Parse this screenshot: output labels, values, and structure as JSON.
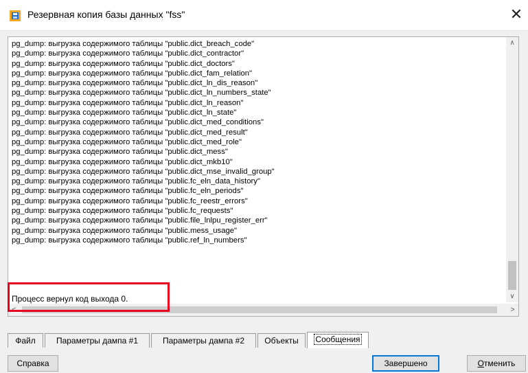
{
  "window": {
    "title": "Резервная копия базы данных \"fss\"",
    "close_glyph": "✕"
  },
  "log": {
    "lines": [
      "pg_dump: выгрузка содержимого таблицы \"public.dict_breach_code\"",
      "pg_dump: выгрузка содержимого таблицы \"public.dict_contractor\"",
      "pg_dump: выгрузка содержимого таблицы \"public.dict_doctors\"",
      "pg_dump: выгрузка содержимого таблицы \"public.dict_fam_relation\"",
      "pg_dump: выгрузка содержимого таблицы \"public.dict_ln_dis_reason\"",
      "pg_dump: выгрузка содержимого таблицы \"public.dict_ln_numbers_state\"",
      "pg_dump: выгрузка содержимого таблицы \"public.dict_ln_reason\"",
      "pg_dump: выгрузка содержимого таблицы \"public.dict_ln_state\"",
      "pg_dump: выгрузка содержимого таблицы \"public.dict_med_conditions\"",
      "pg_dump: выгрузка содержимого таблицы \"public.dict_med_result\"",
      "pg_dump: выгрузка содержимого таблицы \"public.dict_med_role\"",
      "pg_dump: выгрузка содержимого таблицы \"public.dict_mess\"",
      "pg_dump: выгрузка содержимого таблицы \"public.dict_mkb10\"",
      "pg_dump: выгрузка содержимого таблицы \"public.dict_mse_invalid_group\"",
      "pg_dump: выгрузка содержимого таблицы \"public.fc_eln_data_history\"",
      "pg_dump: выгрузка содержимого таблицы \"public.fc_eln_periods\"",
      "pg_dump: выгрузка содержимого таблицы \"public.fc_reestr_errors\"",
      "pg_dump: выгрузка содержимого таблицы \"public.fc_requests\"",
      "pg_dump: выгрузка содержимого таблицы \"public.file_lnlpu_register_err\"",
      "pg_dump: выгрузка содержимого таблицы \"public.mess_usage\"",
      "pg_dump: выгрузка содержимого таблицы \"public.ref_ln_numbers\""
    ],
    "exit_message": "Процесс вернул код выхода 0.",
    "highlight_color": "#e8001c"
  },
  "scrollbars": {
    "up_glyph": "∧",
    "down_glyph": "∨",
    "left_glyph": "<",
    "right_glyph": ">"
  },
  "tabs": [
    {
      "label": "Файл"
    },
    {
      "label": "Параметры дампа #1"
    },
    {
      "label": "Параметры дампа #2"
    },
    {
      "label": "Объекты"
    },
    {
      "label": "Сообщения",
      "active": true
    }
  ],
  "buttons": {
    "help": "Справка",
    "done": "Завершено",
    "cancel_mnemonic": "О",
    "cancel_rest": "тменить"
  },
  "colors": {
    "accent": "#0078d7",
    "icon_blue": "#1e6fd9",
    "icon_orange": "#f5a623"
  }
}
